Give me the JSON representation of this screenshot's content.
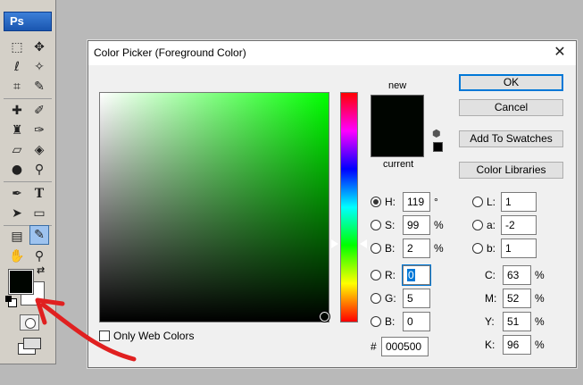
{
  "app": {
    "logo": "Ps"
  },
  "colors": {
    "foreground": "#000500",
    "background": "#ffffff",
    "accent": "#0078d7",
    "arrow": "#e02020"
  },
  "toolbox": {
    "tools": [
      "marquee-icon",
      "move-icon",
      "lasso-icon",
      "magic-wand-icon",
      "crop-icon",
      "eyedropper-slice-icon",
      "healing-brush-icon",
      "brush-icon",
      "clone-stamp-icon",
      "history-brush-icon",
      "eraser-icon",
      "paint-bucket-icon",
      "blur-icon",
      "dodge-icon",
      "pen-icon",
      "type-icon",
      "path-selection-icon",
      "rectangle-icon",
      "notes-icon",
      "eyedropper-icon",
      "hand-icon",
      "zoom-icon"
    ],
    "active_tool": "eyedropper-icon"
  },
  "dialog": {
    "title": "Color Picker (Foreground Color)",
    "close": "✕",
    "label_new": "new",
    "label_current": "current",
    "buttons": {
      "ok": "OK",
      "cancel": "Cancel",
      "add_to_swatches": "Add To Swatches",
      "color_libraries": "Color Libraries"
    },
    "only_web_colors": "Only Web Colors",
    "hsb": {
      "h": {
        "label": "H:",
        "value": "119",
        "unit": "°"
      },
      "s": {
        "label": "S:",
        "value": "99",
        "unit": "%"
      },
      "b": {
        "label": "B:",
        "value": "2",
        "unit": "%"
      }
    },
    "rgb": {
      "r": {
        "label": "R:",
        "value": "0"
      },
      "g": {
        "label": "G:",
        "value": "5"
      },
      "b": {
        "label": "B:",
        "value": "0"
      }
    },
    "lab": {
      "l": {
        "label": "L:",
        "value": "1"
      },
      "a": {
        "label": "a:",
        "value": "-2"
      },
      "b": {
        "label": "b:",
        "value": "1"
      }
    },
    "cmyk": {
      "c": {
        "label": "C:",
        "value": "63",
        "unit": "%"
      },
      "m": {
        "label": "M:",
        "value": "52",
        "unit": "%"
      },
      "y": {
        "label": "Y:",
        "value": "51",
        "unit": "%"
      },
      "k": {
        "label": "K:",
        "value": "96",
        "unit": "%"
      }
    },
    "hex": {
      "label": "#",
      "value": "000500"
    }
  }
}
